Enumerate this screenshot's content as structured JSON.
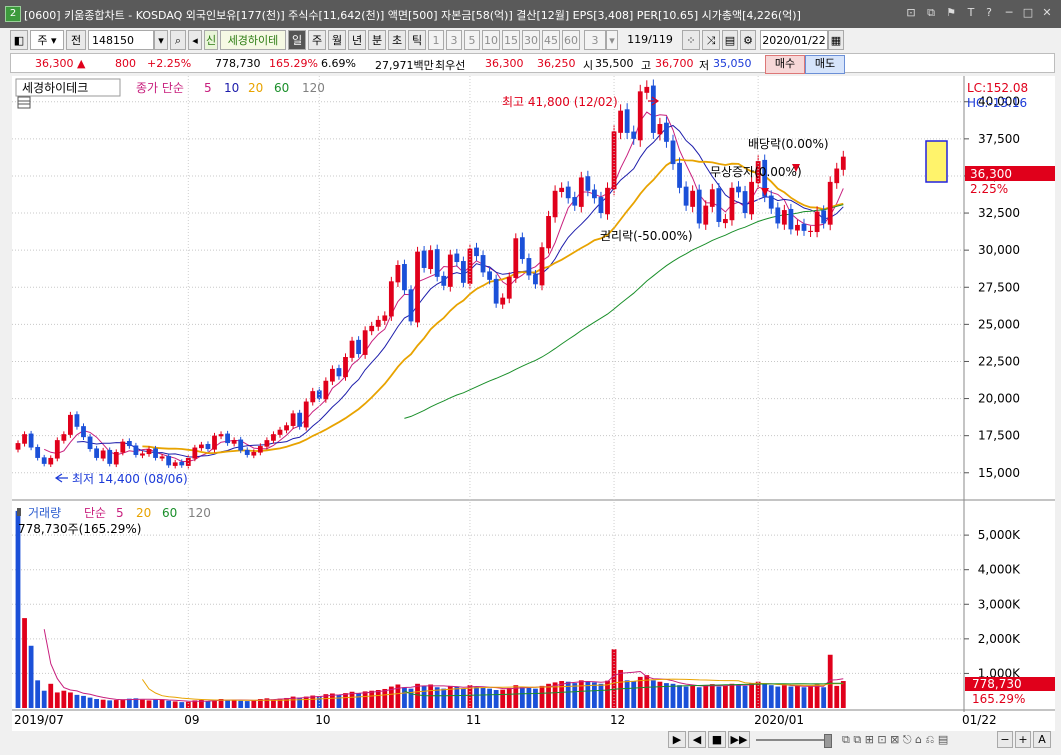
{
  "window": {
    "icon_label": "2",
    "title": "[0600] 키움종합차트 - KOSDAQ 외국인보유[177(천)] 주식수[11,642(천)] 액면[500] 자본금[58(억)] 결산[12월] EPS[3,408] PER[10.65] 시가총액[4,226(억)]",
    "buttons": [
      "⊡",
      "⧉",
      "⚑",
      "T",
      "?",
      "─",
      "□",
      "✕"
    ]
  },
  "toolbar": {
    "period_select": "주",
    "prev_label": "전",
    "code": "148150",
    "new_label": "신",
    "stock_name": "세경하이테",
    "periods": [
      "일",
      "주",
      "월",
      "년",
      "분",
      "초",
      "틱"
    ],
    "active_period": "일",
    "intervals": [
      "1",
      "3",
      "5",
      "10",
      "15",
      "30",
      "45",
      "60"
    ],
    "custom_interval": "3",
    "page_count": "119/119",
    "date": "2020/01/22"
  },
  "quote": {
    "price": "36,300",
    "change_arrow": "▲",
    "change": "800",
    "change_pct": "+2.25%",
    "volume": "778,730",
    "volume_ratio": "165.29%",
    "turnover": "6.69%",
    "amount": "27,971백만",
    "best_label": "최우선",
    "ask": "36,300",
    "bid": "36,250",
    "open_label": "시",
    "open": "35,500",
    "high_label": "고",
    "high": "36,700",
    "low_label": "저",
    "low": "35,050",
    "buy_label": "매수",
    "sell_label": "매도"
  },
  "price_panel": {
    "stock_label": "세경하이테크",
    "ma_title": "종가 단순",
    "ma_periods": [
      "5",
      "10",
      "20",
      "60",
      "120"
    ],
    "ma_colors": [
      "#c8207e",
      "#1d1dab",
      "#e8a300",
      "#1a8f2a",
      "#808080"
    ],
    "lc_label": "LC:152.08",
    "hc_label": "HC:-13.16",
    "last_price": "36,300",
    "last_pct": "2.25%",
    "high_annotation": "최고 41,800 (12/02)",
    "low_annotation": "최저 14,400 (08/06)",
    "event_dividend": "배당락(0.00%)",
    "event_rights": "무상증자(0.00%)",
    "event_split": "권리락(-50.00%)"
  },
  "volume_panel": {
    "title": "거래량",
    "ma_title": "단순",
    "ma_periods": [
      "5",
      "20",
      "60",
      "120"
    ],
    "ma_colors": [
      "#c8207e",
      "#e8a300",
      "#1a8f2a",
      "#808080"
    ],
    "volume_text": "778,730주(165.29%)",
    "last_volume": "778,730",
    "last_pct": "165.29%"
  },
  "chart_data": {
    "type": "candlestick",
    "ylim": [
      13300,
      41600
    ],
    "y_ticks": [
      15000,
      17500,
      20000,
      22500,
      25000,
      27500,
      30000,
      32500,
      35000,
      37500,
      40000
    ],
    "y_tick_labels": [
      "15,000",
      "17,500",
      "20,000",
      "22,500",
      "25,000",
      "27,500",
      "30,000",
      "32,500",
      "35,000",
      "37,500",
      "40,000"
    ],
    "volume_ylim": [
      0,
      5900
    ],
    "volume_ticks": [
      1000,
      2000,
      3000,
      4000,
      5000
    ],
    "volume_tick_labels": [
      "1,000K",
      "2,000K",
      "3,000K",
      "4,000K",
      "5,000K"
    ],
    "x_labels": [
      {
        "label": "2019/07",
        "index": 0
      },
      {
        "label": "09",
        "index": 26
      },
      {
        "label": "10",
        "index": 46
      },
      {
        "label": "11",
        "index": 69
      },
      {
        "label": "12",
        "index": 91
      },
      {
        "label": "2020/01",
        "index": 113
      },
      {
        "label": "01/22",
        "index": 139
      }
    ],
    "closes": [
      17000,
      17600,
      16700,
      16000,
      15600,
      16000,
      17200,
      17600,
      18900,
      18100,
      17400,
      16600,
      16000,
      16500,
      15600,
      16400,
      17100,
      16800,
      16200,
      16300,
      16600,
      16000,
      16100,
      15500,
      15700,
      15500,
      16000,
      16700,
      16900,
      16600,
      17500,
      17600,
      17000,
      17200,
      16500,
      16200,
      16400,
      16800,
      17200,
      17600,
      17900,
      18200,
      19000,
      18100,
      19800,
      20500,
      20000,
      21200,
      22000,
      21500,
      22800,
      23900,
      23000,
      24600,
      24900,
      25300,
      25600,
      27900,
      29000,
      27300,
      25200,
      29900,
      28800,
      30000,
      28200,
      27600,
      29700,
      29200,
      27800,
      30100,
      29600,
      28500,
      28000,
      26400,
      26800,
      28200,
      30800,
      29400,
      28300,
      27700,
      30200,
      32300,
      34000,
      34200,
      33500,
      33000,
      34900,
      34000,
      33500,
      32500,
      34200,
      38000,
      39400,
      37900,
      37500,
      40700,
      41000,
      37900,
      38500,
      37300,
      35800,
      34200,
      33000,
      34000,
      31800,
      33000,
      34100,
      31900,
      32100,
      34200,
      33900,
      32500,
      34600,
      36000,
      33600,
      32800,
      31800,
      32700,
      31400,
      31700,
      31300,
      31300,
      32600,
      31800,
      34600,
      35500,
      36300
    ],
    "volume_k": [
      5700,
      2600,
      1800,
      800,
      500,
      700,
      450,
      500,
      450,
      380,
      350,
      300,
      260,
      240,
      220,
      230,
      250,
      270,
      280,
      240,
      220,
      240,
      250,
      210,
      190,
      170,
      180,
      220,
      230,
      200,
      220,
      260,
      230,
      240,
      210,
      200,
      220,
      260,
      280,
      250,
      270,
      290,
      330,
      300,
      330,
      360,
      340,
      400,
      420,
      380,
      430,
      470,
      420,
      480,
      500,
      520,
      550,
      620,
      680,
      600,
      560,
      700,
      650,
      680,
      600,
      560,
      640,
      620,
      570,
      660,
      620,
      590,
      560,
      520,
      530,
      580,
      660,
      620,
      580,
      560,
      640,
      700,
      740,
      780,
      760,
      720,
      800,
      770,
      740,
      700,
      790,
      1700,
      1100,
      800,
      780,
      900,
      950,
      800,
      760,
      720,
      700,
      660,
      620,
      640,
      600,
      660,
      690,
      620,
      640,
      700,
      680,
      640,
      720,
      760,
      700,
      660,
      620,
      660,
      620,
      640,
      600,
      620,
      680,
      600,
      1540,
      640,
      780
    ]
  },
  "bottombar": {
    "nav_buttons": [
      "▶",
      "◀",
      "■",
      "▶▶"
    ],
    "zoom": [
      "−",
      "+",
      "A"
    ]
  }
}
